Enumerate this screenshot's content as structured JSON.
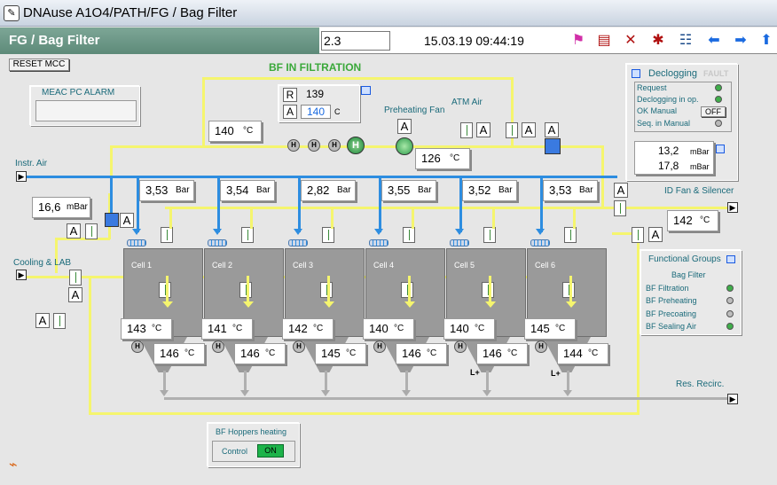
{
  "window": {
    "title": "DNAuse A1O4/PATH/FG / Bag Filter"
  },
  "header": {
    "page_title": "FG / Bag Filter",
    "zoom_value": "2.3",
    "datetime": "15.03.19 09:44:19",
    "icons": [
      "flag-icon",
      "report-icon",
      "bell-off-icon",
      "alarm-off-icon",
      "tree-icon",
      "back-arrow-icon",
      "forward-arrow-icon",
      "up-arrow-icon"
    ]
  },
  "toolbar": {
    "reset_mcc": "RESET MCC"
  },
  "status": {
    "filtration": "BF IN FILTRATION"
  },
  "alarm_panel": {
    "title": "MEAC PC ALARM",
    "value": ""
  },
  "setpoint": {
    "r_label": "R",
    "r_value": "139",
    "a_label": "A",
    "a_value": "140",
    "unit": "C"
  },
  "preheat": {
    "temp": "140",
    "unit": "°C",
    "fan_label": "Preheating Fan",
    "fan_temp": "126",
    "fan_unit": "°C",
    "atm_air": "ATM Air"
  },
  "instr_air": {
    "label": "Instr. Air",
    "pressure": "16,6",
    "unit": "mBar"
  },
  "cooling": {
    "label": "Cooling & LAB"
  },
  "id_fan": {
    "label": "ID Fan & Silencer",
    "temp": "142",
    "unit": "°C"
  },
  "res_recirc": {
    "label": "Res. Recirc."
  },
  "cells": [
    {
      "name": "Cell 1",
      "pressure": "3,53",
      "p_unit": "Bar",
      "top_temp": "143",
      "bot_temp": "146",
      "t_unit": "°C"
    },
    {
      "name": "Cell 2",
      "pressure": "3,54",
      "p_unit": "Bar",
      "top_temp": "141",
      "bot_temp": "146",
      "t_unit": "°C"
    },
    {
      "name": "Cell 3",
      "pressure": "2,82",
      "p_unit": "Bar",
      "top_temp": "142",
      "bot_temp": "145",
      "t_unit": "°C"
    },
    {
      "name": "Cell 4",
      "pressure": "3,55",
      "p_unit": "Bar",
      "top_temp": "140",
      "bot_temp": "146",
      "t_unit": "°C"
    },
    {
      "name": "Cell 5",
      "pressure": "3,52",
      "p_unit": "Bar",
      "top_temp": "140",
      "bot_temp": "146",
      "t_unit": "°C"
    },
    {
      "name": "Cell 6",
      "pressure": "3,53",
      "p_unit": "Bar",
      "top_temp": "145",
      "bot_temp": "144",
      "t_unit": "°C"
    }
  ],
  "decloging": {
    "title": "Declogging",
    "fault": "FAULT",
    "rows": [
      "Request",
      "Declogging in op.",
      "OK Manual",
      "Seq. in Manual"
    ],
    "off_label": "OFF",
    "val1": "13,2",
    "val1_unit": "mBar",
    "val2": "17,8",
    "val2_unit": "mBar"
  },
  "functional_groups": {
    "title": "Functional Groups",
    "subtitle": "Bag Filter",
    "items": [
      "BF Filtration",
      "BF Preheating",
      "BF Precoating",
      "BF Sealing Air"
    ]
  },
  "hoppers": {
    "title": "BF Hoppers heating",
    "control": "Control",
    "state": "ON"
  },
  "markers": {
    "a": "A",
    "h": "H",
    "l_plus": "L+"
  },
  "colors": {
    "pipe_yellow": "#f5f56e",
    "pipe_blue": "#2d8de0",
    "header_green": "#6f9a89",
    "led_green": "#3fae4a",
    "on_green": "#1db34a"
  }
}
